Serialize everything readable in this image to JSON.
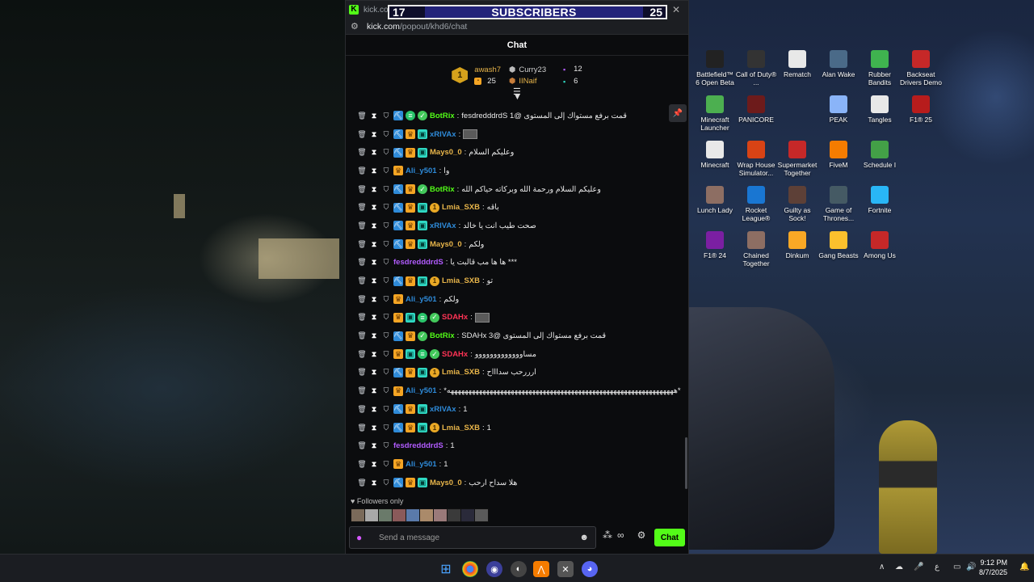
{
  "browser": {
    "tab_title": "kick.com",
    "url_host": "kick.com",
    "url_path": "/popout/khd6/chat"
  },
  "overlay": {
    "left_count": "17",
    "label": "SUBSCRIBERS",
    "right_count": "25"
  },
  "chat": {
    "header": "Chat",
    "leaderboard": {
      "rank": "1",
      "top_user": "awash7",
      "top_count": "25",
      "second_user": "Curry23",
      "second_count": "12",
      "third_user": "IINaif",
      "third_count": "6"
    },
    "messages": [
      {
        "user": "BotRix",
        "color": "#53fc18",
        "text": "قمت برفع مستواك إلى المستوى @fesdredddrdS 1",
        "badges": [
          "pick",
          "green",
          "verified"
        ]
      },
      {
        "user": "xRIVAx",
        "color": "#2e8ad8",
        "text": "",
        "emote": true,
        "badges": [
          "pick",
          "crown",
          "sub"
        ]
      },
      {
        "user": "Mays0_0",
        "color": "#e8b54a",
        "text": "وعليكم السلام",
        "badges": [
          "pick",
          "crown",
          "sub"
        ]
      },
      {
        "user": "Ali_y501",
        "color": "#2e8ad8",
        "text": "وا",
        "badges": [
          "crown"
        ]
      },
      {
        "user": "BotRix",
        "color": "#53fc18",
        "text": "وعليكم السلام ورحمة الله وبركاته حياكم الله",
        "badges": [
          "pick",
          "crown",
          "verified"
        ]
      },
      {
        "user": "Lmia_SXB",
        "color": "#e8b54a",
        "text": "باقه",
        "badges": [
          "pick",
          "crown",
          "sub",
          "coin"
        ]
      },
      {
        "user": "xRIVAx",
        "color": "#2e8ad8",
        "text": "صحت طيب انت يا خالد",
        "badges": [
          "pick",
          "crown",
          "sub"
        ]
      },
      {
        "user": "Mays0_0",
        "color": "#e8b54a",
        "text": "ولكم",
        "badges": [
          "pick",
          "crown",
          "sub"
        ]
      },
      {
        "user": "fesdredddrdS",
        "color": "#b25cff",
        "text": "*** ها ها مب قالبت يا",
        "badges": []
      },
      {
        "user": "Lmia_SXB",
        "color": "#e8b54a",
        "text": "تو",
        "badges": [
          "pick",
          "crown",
          "sub",
          "coin"
        ]
      },
      {
        "user": "Ali_y501",
        "color": "#2e8ad8",
        "text": "ولكم",
        "badges": [
          "crown"
        ]
      },
      {
        "user": "SDAHx",
        "color": "#ff3355",
        "text": "",
        "emote": true,
        "badges": [
          "crown",
          "sub",
          "green",
          "verified"
        ]
      },
      {
        "user": "BotRix",
        "color": "#53fc18",
        "text": "قمت برفع مستواك إلى المستوى @SDAHx 3",
        "badges": [
          "pick",
          "crown",
          "verified"
        ]
      },
      {
        "user": "SDAHx",
        "color": "#ff3355",
        "text": "مساووووووووووووو",
        "badges": [
          "crown",
          "sub",
          "green",
          "verified"
        ]
      },
      {
        "user": "Lmia_SXB",
        "color": "#e8b54a",
        "text": "ارررحب سداااح",
        "badges": [
          "pick",
          "crown",
          "sub",
          "coin"
        ]
      },
      {
        "user": "Ali_y501",
        "color": "#2e8ad8",
        "text": "*ههههههههههههههههههههههههههههههههههههههههههههههههههههههههههههههههه*",
        "badges": [
          "crown"
        ]
      },
      {
        "user": "xRIVAx",
        "color": "#2e8ad8",
        "text": "1",
        "badges": [
          "pick",
          "crown",
          "sub"
        ]
      },
      {
        "user": "Lmia_SXB",
        "color": "#e8b54a",
        "text": "1",
        "badges": [
          "pick",
          "crown",
          "sub",
          "coin"
        ]
      },
      {
        "user": "fesdredddrdS",
        "color": "#b25cff",
        "text": "1",
        "badges": []
      },
      {
        "user": "Ali_y501",
        "color": "#2e8ad8",
        "text": "1",
        "badges": [
          "crown"
        ]
      },
      {
        "user": "Mays0_0",
        "color": "#e8b54a",
        "text": "هلا سداح ارحب",
        "badges": [
          "pick",
          "crown",
          "sub"
        ]
      }
    ],
    "followers_label": "Followers only",
    "input_placeholder": "Send a message",
    "send_label": "Chat"
  },
  "desktop_icons": [
    {
      "label": "Battlefield™ 6 Open Beta",
      "color": "#222"
    },
    {
      "label": "Call of Duty® ...",
      "color": "#333"
    },
    {
      "label": "Rematch",
      "color": "#e8e8e8"
    },
    {
      "label": "Alan Wake",
      "color": "#4a6a88"
    },
    {
      "label": "Rubber Bandits",
      "color": "#3fb34f"
    },
    {
      "label": "Backseat Drivers Demo",
      "color": "#c62828"
    },
    {
      "label": "Minecraft Launcher",
      "color": "#4caf50"
    },
    {
      "label": "PANICORE",
      "color": "#6d1b1b"
    },
    {
      "label": "PEAK",
      "color": "#8ab4f8"
    },
    {
      "label": "Tangles",
      "color": "#e8e8e8"
    },
    {
      "label": "F1® 25",
      "color": "#b71c1c"
    },
    {
      "label": "Minecraft",
      "color": "#e8e8e8"
    },
    {
      "label": "Wrap House Simulator...",
      "color": "#d84315"
    },
    {
      "label": "Supermarket Together",
      "color": "#c62828"
    },
    {
      "label": "FiveM",
      "color": "#f57c00"
    },
    {
      "label": "Schedule I",
      "color": "#43a047"
    },
    {
      "label": "Lunch Lady",
      "color": "#8d6e63"
    },
    {
      "label": "Rocket League®",
      "color": "#1976d2"
    },
    {
      "label": "Guilty as Sock!",
      "color": "#5d4037"
    },
    {
      "label": "Game of Thrones...",
      "color": "#455a64"
    },
    {
      "label": "Fortnite",
      "color": "#29b6f6"
    },
    {
      "label": "F1® 24",
      "color": "#7b1fa2"
    },
    {
      "label": "Chained Together",
      "color": "#8d6e63"
    },
    {
      "label": "Dinkum",
      "color": "#f9a825"
    },
    {
      "label": "Gang Beasts",
      "color": "#fbc02d"
    },
    {
      "label": "Among Us",
      "color": "#c62828"
    }
  ],
  "taskbar": {
    "time": "9:12 PM",
    "date": "8/7/2025",
    "lang": "ع"
  }
}
